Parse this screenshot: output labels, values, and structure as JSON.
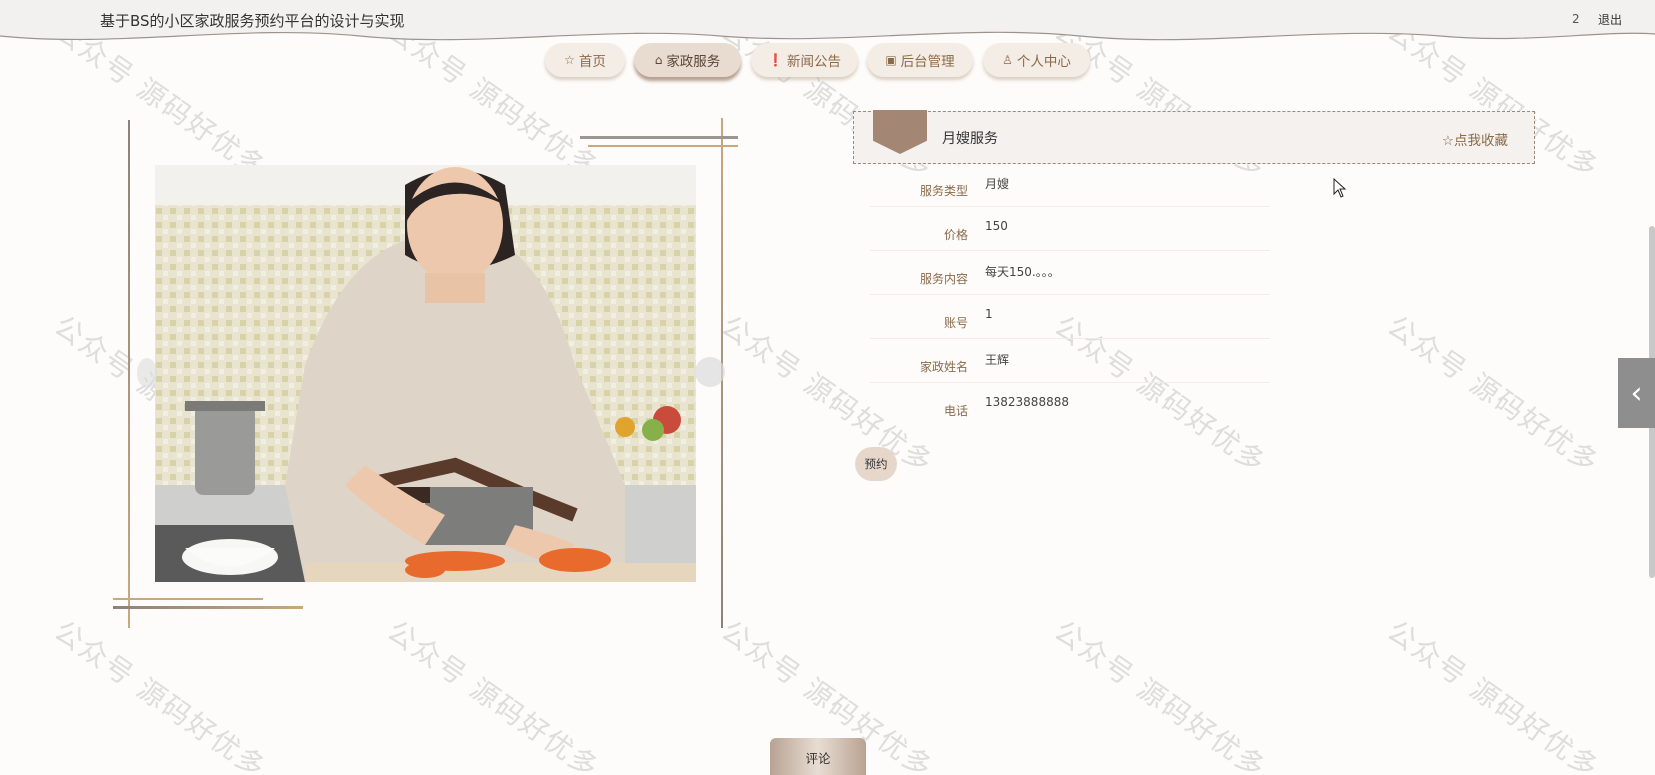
{
  "header": {
    "title": "基于BS的小区家政服务预约平台的设计与实现",
    "user_id": "2",
    "logout": "退出"
  },
  "nav": [
    {
      "label": "首页",
      "icon": "star-icon",
      "glyph": "☆"
    },
    {
      "label": "家政服务",
      "icon": "bag-icon",
      "glyph": "⌂"
    },
    {
      "label": "新闻公告",
      "icon": "info-icon",
      "glyph": "❗"
    },
    {
      "label": "后台管理",
      "icon": "box-icon",
      "glyph": "▣"
    },
    {
      "label": "个人中心",
      "icon": "user-icon",
      "glyph": "♙"
    }
  ],
  "detail": {
    "title": "月嫂服务",
    "favorite": "☆点我收藏",
    "fields": [
      {
        "label": "服务类型",
        "value": "月嫂"
      },
      {
        "label": "价格",
        "value": "150"
      },
      {
        "label": "服务内容",
        "value": "每天150.。。。"
      },
      {
        "label": "账号",
        "value": "1"
      },
      {
        "label": "家政姓名",
        "value": "王辉"
      },
      {
        "label": "电话",
        "value": "13823888888"
      }
    ],
    "book_button": "预约"
  },
  "comment_button": "评论",
  "watermark": "公众号 源码好优多",
  "colors": {
    "accent": "#8b6a4a",
    "nav_bg": "#f3ede6",
    "badge": "#a38673"
  }
}
